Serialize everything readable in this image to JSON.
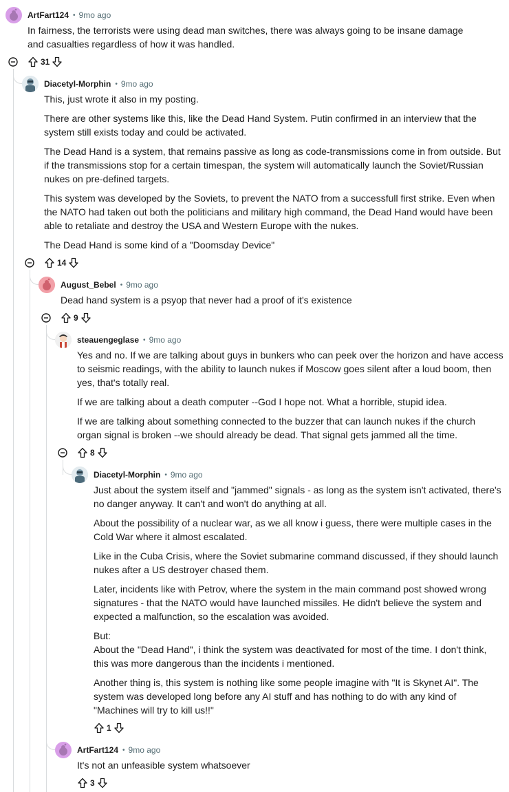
{
  "comments": [
    {
      "author": "ArtFart124",
      "time": "9mo ago",
      "paragraphs": [
        "In fairness, the terrorists were using dead man switches, there was always going to be insane damage and casualties regardless of how it was handled."
      ],
      "votes": "31"
    },
    {
      "author": "Diacetyl-Morphin",
      "time": "9mo ago",
      "paragraphs": [
        "This, just wrote it also in my posting.",
        "There are other systems like this, like the Dead Hand System. Putin confirmed in an interview that the system still exists today and could be activated.",
        "The Dead Hand is a system, that remains passive as long as code-transmissions come in from outside. But if the transmissions stop for a certain timespan, the system will automatically launch the Soviet/Russian nukes on pre-defined targets.",
        "This system was developed by the Soviets, to prevent the NATO from a successfull first strike. Even when the NATO had taken out both the politicians and military high command, the Dead Hand would have been able to retaliate and destroy the USA and Western Europe with the nukes.",
        "The Dead Hand is some kind of a \"Doomsday Device\""
      ],
      "votes": "14"
    },
    {
      "author": "August_Bebel",
      "time": "9mo ago",
      "paragraphs": [
        "Dead hand system is a psyop that never had a proof of it's existence"
      ],
      "votes": "9"
    },
    {
      "author": "steauengeglase",
      "time": "9mo ago",
      "paragraphs": [
        "Yes and no. If we are talking about guys in bunkers who can peek over the horizon and have access to seismic readings, with the ability to launch nukes if Moscow goes silent after a loud boom, then yes, that's totally real.",
        "If we are talking about a death computer --God I hope not. What a horrible, stupid idea.",
        "If we are talking about something connected to the buzzer that can launch nukes if the church organ signal is broken --we should already be dead. That signal gets jammed all the time."
      ],
      "votes": "8"
    },
    {
      "author": "Diacetyl-Morphin",
      "time": "9mo ago",
      "paragraphs": [
        "Just about the system itself and \"jammed\" signals - as long as the system isn't activated, there's no danger anyway. It can't and won't do anything at all.",
        "About the possibility of a nuclear war, as we all know i guess, there were multiple cases in the Cold War where it almost escalated.",
        "Like in the Cuba Crisis, where the Soviet submarine command discussed, if they should launch nukes after a US destroyer chased them.",
        "Later, incidents like with Petrov, where the system in the main command post showed wrong signatures - that the NATO would have launched missiles. He didn't believe the system and expected a malfunction, so the escalation was avoided.",
        "But:\nAbout the \"Dead Hand\", i think the system was deactivated for most of the time. I don't think, this was more dangerous than the incidents i mentioned.",
        "Another thing is, this system is nothing like some people imagine with \"It is Skynet AI\". The system was developed long before any AI stuff and has nothing to do with any kind of \"Machines will try to kill us!!\""
      ],
      "votes": "1"
    },
    {
      "author": "ArtFart124",
      "time": "9mo ago",
      "paragraphs": [
        "It's not an unfeasible system whatsoever"
      ],
      "votes": "3"
    }
  ],
  "icons": {
    "upvote": "upvote-arrow-icon",
    "downvote": "downvote-arrow-icon",
    "collapse": "collapse-minus-icon"
  },
  "colors": {
    "text": "#1c1c1c",
    "meta": "#576f76",
    "thread_line": "#d9dcde",
    "avatar_pink_purple": "#d89ee8",
    "avatar_red": "#f2a0a8"
  }
}
